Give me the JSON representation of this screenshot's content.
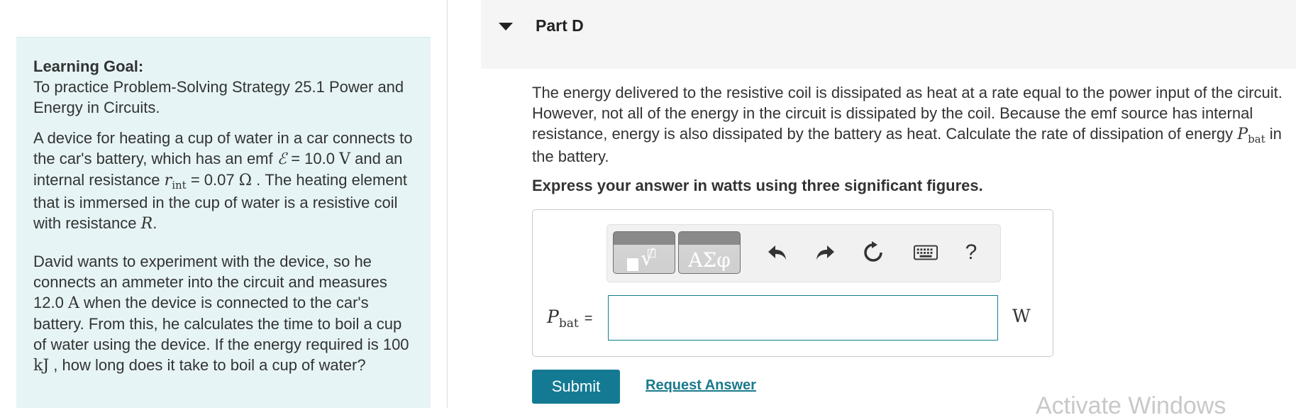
{
  "learning_goal": {
    "heading": "Learning Goal:",
    "text": "To practice Problem-Solving Strategy 25.1 Power and Energy in Circuits."
  },
  "problem": {
    "p1": {
      "a": "A device for heating a cup of water in a car connects to the car's battery, which has an emf",
      "emf_symbol": "ℰ",
      "b": "= 10.0",
      "unit_v": "V",
      "c": "and an internal resistance",
      "r_symbol": "r",
      "r_sub": "int",
      "d": "= 0.07",
      "unit_ohm": "Ω",
      "e": ". The heating element that is immersed in the cup of water is a resistive coil with resistance",
      "R_symbol": "R",
      "f": "."
    },
    "p2": {
      "a": "David wants to experiment with the device, so he connects an ammeter into the circuit and measures 12.0",
      "unit_a": "A",
      "b": "when the device is connected to the car's battery. From this, he calculates the time to boil a cup of water using the device. If the energy required is 100",
      "unit_kj": "kJ",
      "c": ", how long does it take to boil a cup of water?"
    }
  },
  "part": {
    "title": "Part D",
    "question_a": "The energy delivered to the resistive coil is dissipated as heat at a rate equal to the power input of the circuit. However, not all of the energy in the circuit is dissipated by the coil. Because the emf source has internal resistance, energy is also dissipated by the battery as heat. Calculate the rate of dissipation of energy",
    "question_symbol": "P",
    "question_sub": "bat",
    "question_b": "in the battery.",
    "instruction": "Express your answer in watts using three significant figures."
  },
  "toolbar": {
    "templates_icon": "templates-icon",
    "greek_label": "ΑΣφ",
    "undo_icon": "undo-icon",
    "redo_icon": "redo-icon",
    "reset_icon": "reset-icon",
    "keyboard_icon": "keyboard-icon",
    "help_label": "?"
  },
  "answer": {
    "var_symbol": "P",
    "var_sub": "bat",
    "equals": "=",
    "value": "",
    "unit": "W"
  },
  "actions": {
    "submit_label": "Submit",
    "request_label": "Request Answer"
  },
  "watermark": "Activate Windows",
  "colors": {
    "panel_bg": "#e6f4f5",
    "submit_bg": "#147a93",
    "link": "#1a7a8c",
    "input_border": "#107f8f"
  }
}
